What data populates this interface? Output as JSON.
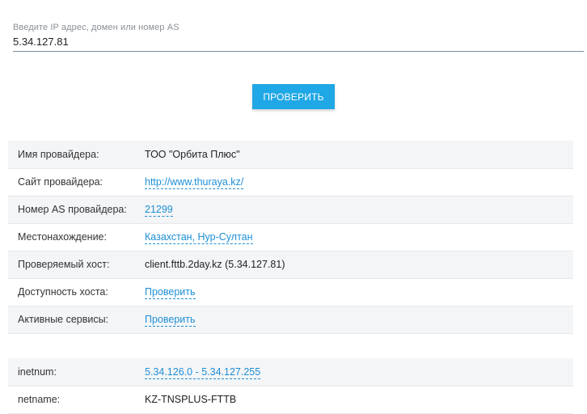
{
  "search": {
    "label": "Введите IP адрес, домен или номер AS",
    "value": "5.34.127.81"
  },
  "check_button": {
    "label": "ПРОВЕРИТЬ"
  },
  "info_rows": [
    {
      "key": "Имя провайдера:",
      "value": "ТОО \"Орбита Плюс\"",
      "link": false
    },
    {
      "key": "Сайт провайдера:",
      "value": "http://www.thuraya.kz/",
      "link": true
    },
    {
      "key": "Номер AS провайдера:",
      "value": "21299",
      "link": true
    },
    {
      "key": "Местонахождение:",
      "value": "Казахстан, Нур-Султан",
      "link": true
    },
    {
      "key": "Проверяемый хост:",
      "value": "client.fttb.2day.kz (5.34.127.81)",
      "link": false
    },
    {
      "key": "Доступность хоста:",
      "value": "Проверить",
      "link": true
    },
    {
      "key": "Активные сервисы:",
      "value": "Проверить",
      "link": true
    }
  ],
  "whois_rows": [
    {
      "key": "inetnum:",
      "value": "5.34.126.0 - 5.34.127.255",
      "link": true
    },
    {
      "key": "netname:",
      "value": "KZ-TNSPLUS-FTTB",
      "link": false
    }
  ]
}
